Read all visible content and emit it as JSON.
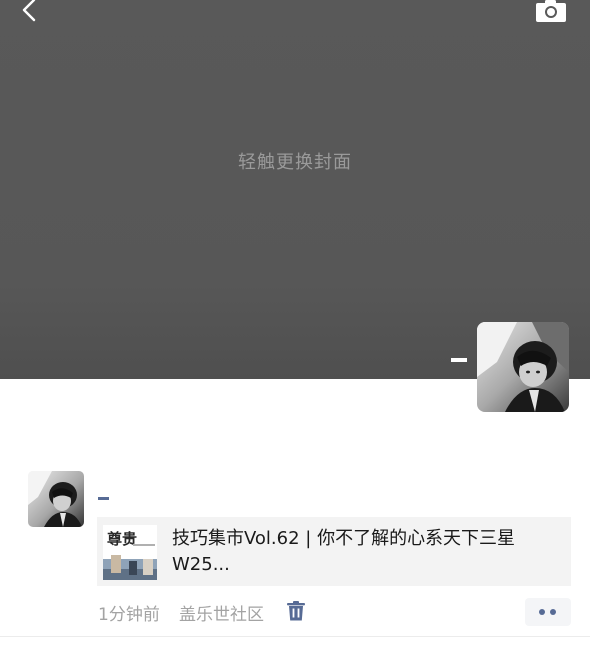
{
  "cover": {
    "hint": "轻触更换封面"
  },
  "profile": {
    "nickname": "–"
  },
  "moment": {
    "nickname": "–",
    "share": {
      "thumbnail_caption": "尊贵",
      "title": "技巧集市Vol.62 | 你不了解的心系天下三星W25..."
    },
    "time": "1分钟前",
    "source": "盖乐世社区"
  },
  "icons": {
    "back": "chevron-left-icon",
    "camera": "camera-icon",
    "delete": "trash-icon",
    "more": "more-dots-icon"
  },
  "colors": {
    "cover_bg": "#575757",
    "link_blue": "#576b95",
    "meta_gray": "#a3a3a3",
    "card_bg": "#f3f3f3"
  }
}
